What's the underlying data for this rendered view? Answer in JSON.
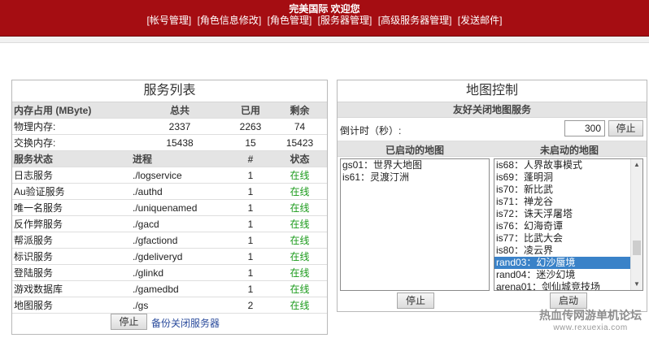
{
  "header": {
    "welcome": "完美国际 欢迎您",
    "nav": [
      "帐号管理",
      "角色信息修改",
      "角色管理",
      "服务器管理",
      "高级服务器管理",
      "发送邮件"
    ]
  },
  "service_panel": {
    "title": "服务列表",
    "memory_headers": [
      "内存占用 (MByte)",
      "总共",
      "已用",
      "剩余"
    ],
    "memory_rows": [
      {
        "name": "物理内存:",
        "total": "2337",
        "used": "2263",
        "free": "74"
      },
      {
        "name": "交换内存:",
        "total": "15438",
        "used": "15",
        "free": "15423"
      }
    ],
    "service_headers": [
      "服务状态",
      "进程",
      "#",
      "状态"
    ],
    "services": [
      {
        "name": "日志服务",
        "process": "./logservice",
        "count": "1",
        "status": "在线"
      },
      {
        "name": "Au验证服务",
        "process": "./authd",
        "count": "1",
        "status": "在线"
      },
      {
        "name": "唯一名服务",
        "process": "./uniquenamed",
        "count": "1",
        "status": "在线"
      },
      {
        "name": "反作弊服务",
        "process": "./gacd",
        "count": "1",
        "status": "在线"
      },
      {
        "name": "帮派服务",
        "process": "./gfactiond",
        "count": "1",
        "status": "在线"
      },
      {
        "name": "标识服务",
        "process": "./gdeliveryd",
        "count": "1",
        "status": "在线"
      },
      {
        "name": "登陆服务",
        "process": "./glinkd",
        "count": "1",
        "status": "在线"
      },
      {
        "name": "游戏数据库",
        "process": "./gamedbd",
        "count": "1",
        "status": "在线"
      },
      {
        "name": "地图服务",
        "process": "./gs",
        "count": "2",
        "status": "在线"
      }
    ],
    "stop_button": "停止",
    "backup_link": "备份关闭服务器"
  },
  "map_panel": {
    "title": "地图控制",
    "friendly_close": "友好关闭地图服务",
    "countdown_label": "倒计时（秒）:",
    "countdown_value": "300",
    "countdown_stop": "停止",
    "started_header": "已启动的地图",
    "not_started_header": "未启动的地图",
    "started_maps": [
      "gs01：世界大地图",
      "is61：灵渡汀洲"
    ],
    "not_started_maps": [
      "is68：人界故事模式",
      "is69：蓬明洞",
      "is70：新比武",
      "is71：禅龙谷",
      "is72：诛天浮屠塔",
      "is76：幻海奇谭",
      "is77：比武大会",
      "is80：凌云界",
      "rand03：幻沙蜃境",
      "rand04：迷沙幻境",
      "arena01：剑仙城竞技场"
    ],
    "selected_map": "rand03：幻沙蜃境",
    "stop_button": "停止",
    "start_button": "启动"
  },
  "watermark": {
    "line1": "热血传网游单机论坛",
    "line2": "www.rexuexia.com"
  },
  "colors": {
    "header_bg": "#a50d12",
    "online_status": "#1a9a1a",
    "selection": "#3a82c8",
    "link": "#2a4b9c"
  }
}
